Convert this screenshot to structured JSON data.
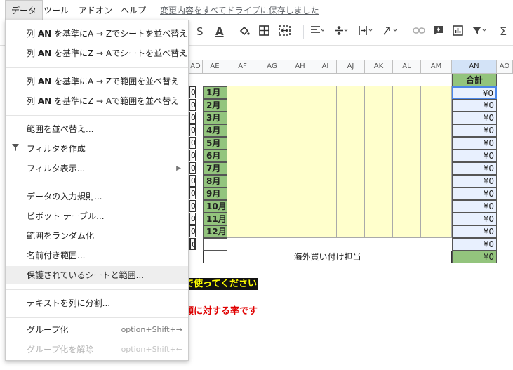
{
  "menubar": {
    "items": [
      "データ",
      "ツール",
      "アドオン",
      "ヘルプ"
    ],
    "save_status": "変更内容をすべてドライブに保存しました"
  },
  "toolbar": {
    "icons": [
      "strikethrough-icon",
      "text-color-icon",
      "fill-color-icon",
      "borders-icon",
      "merge-cells-icon",
      "horizontal-align-icon",
      "vertical-align-icon",
      "text-wrap-icon",
      "text-rotation-icon",
      "insert-link-icon",
      "insert-comment-icon",
      "insert-chart-icon",
      "filter-icon",
      "functions-icon"
    ],
    "strike_glyph": "S",
    "textcolor_glyph": "A",
    "sigma_glyph": "Σ"
  },
  "columns": [
    "AD",
    "AE",
    "AF",
    "AG",
    "AH",
    "AI",
    "AJ",
    "AK",
    "AL",
    "AM",
    "AN",
    "AO"
  ],
  "months": [
    "1月",
    "2月",
    "3月",
    "4月",
    "5月",
    "6月",
    "7月",
    "8月",
    "9月",
    "10月",
    "11月",
    "12月"
  ],
  "total_header": "合計",
  "total_values": [
    "¥0",
    "¥0",
    "¥0",
    "¥0",
    "¥0",
    "¥0",
    "¥0",
    "¥0",
    "¥0",
    "¥0",
    "¥0",
    "¥0",
    "¥0"
  ],
  "buyer_label": "海外買い付け担当",
  "buyer_total": "¥0",
  "left_fragment": "0",
  "black_banner": "で使ってください",
  "red_note": "額に対する率です",
  "dropdown": {
    "items": [
      {
        "prefix": "列 ",
        "bold": "AN",
        "suffix": " を基準にA → Zでシートを並べ替え"
      },
      {
        "prefix": "列 ",
        "bold": "AN",
        "suffix": " を基準にZ → Aでシートを並べ替え"
      },
      {
        "prefix": "列 ",
        "bold": "AN",
        "suffix": " を基準にA → Zで範囲を並べ替え"
      },
      {
        "prefix": "列 ",
        "bold": "AN",
        "suffix": " を基準にZ → Aで範囲を並べ替え"
      },
      {
        "label": "範囲を並べ替え..."
      },
      {
        "label": "フィルタを作成"
      },
      {
        "label": "フィルタ表示..."
      },
      {
        "label": "データの入力規則..."
      },
      {
        "label": "ピボット テーブル..."
      },
      {
        "label": "範囲をランダム化"
      },
      {
        "label": "名前付き範囲..."
      },
      {
        "label": "保護されているシートと範囲..."
      },
      {
        "label": "テキストを列に分割..."
      },
      {
        "label": "グループ化",
        "shortcut": "option+Shift+→"
      },
      {
        "label": "グループ化を解除",
        "shortcut": "option+Shift+←"
      }
    ]
  }
}
